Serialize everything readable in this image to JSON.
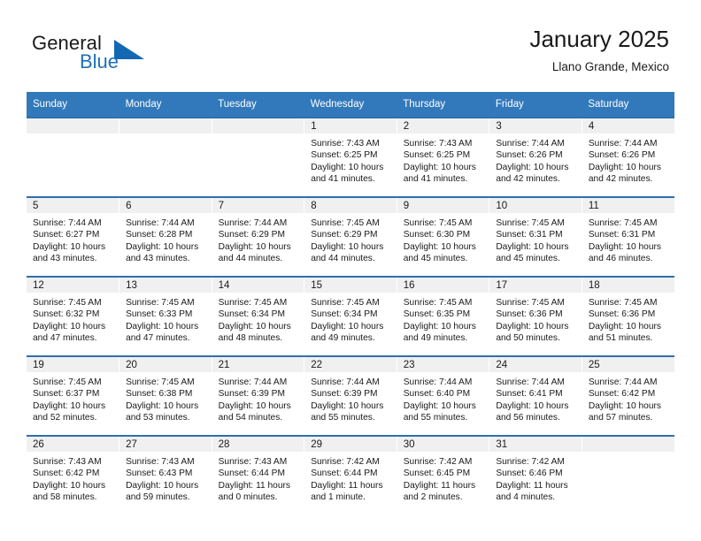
{
  "brand": {
    "name_part1": "General",
    "name_part2": "Blue",
    "logo_icon": "triangle-logo-icon",
    "accent_color": "#1368b3"
  },
  "header": {
    "title": "January 2025",
    "subtitle": "Llano Grande, Mexico"
  },
  "calendar": {
    "header_color": "#3279bb",
    "row_border_color": "#2f6fae",
    "daynum_band_color": "#f0f0f0",
    "weekday_headers": [
      "Sunday",
      "Monday",
      "Tuesday",
      "Wednesday",
      "Thursday",
      "Friday",
      "Saturday"
    ],
    "weeks": [
      [
        {
          "day": "",
          "empty": true,
          "sunrise": "",
          "sunset": "",
          "daylight_line1": "",
          "daylight_line2": ""
        },
        {
          "day": "",
          "empty": true,
          "sunrise": "",
          "sunset": "",
          "daylight_line1": "",
          "daylight_line2": ""
        },
        {
          "day": "",
          "empty": true,
          "sunrise": "",
          "sunset": "",
          "daylight_line1": "",
          "daylight_line2": ""
        },
        {
          "day": "1",
          "empty": false,
          "sunrise": "Sunrise: 7:43 AM",
          "sunset": "Sunset: 6:25 PM",
          "daylight_line1": "Daylight: 10 hours",
          "daylight_line2": "and 41 minutes."
        },
        {
          "day": "2",
          "empty": false,
          "sunrise": "Sunrise: 7:43 AM",
          "sunset": "Sunset: 6:25 PM",
          "daylight_line1": "Daylight: 10 hours",
          "daylight_line2": "and 41 minutes."
        },
        {
          "day": "3",
          "empty": false,
          "sunrise": "Sunrise: 7:44 AM",
          "sunset": "Sunset: 6:26 PM",
          "daylight_line1": "Daylight: 10 hours",
          "daylight_line2": "and 42 minutes."
        },
        {
          "day": "4",
          "empty": false,
          "sunrise": "Sunrise: 7:44 AM",
          "sunset": "Sunset: 6:26 PM",
          "daylight_line1": "Daylight: 10 hours",
          "daylight_line2": "and 42 minutes."
        }
      ],
      [
        {
          "day": "5",
          "empty": false,
          "sunrise": "Sunrise: 7:44 AM",
          "sunset": "Sunset: 6:27 PM",
          "daylight_line1": "Daylight: 10 hours",
          "daylight_line2": "and 43 minutes."
        },
        {
          "day": "6",
          "empty": false,
          "sunrise": "Sunrise: 7:44 AM",
          "sunset": "Sunset: 6:28 PM",
          "daylight_line1": "Daylight: 10 hours",
          "daylight_line2": "and 43 minutes."
        },
        {
          "day": "7",
          "empty": false,
          "sunrise": "Sunrise: 7:44 AM",
          "sunset": "Sunset: 6:29 PM",
          "daylight_line1": "Daylight: 10 hours",
          "daylight_line2": "and 44 minutes."
        },
        {
          "day": "8",
          "empty": false,
          "sunrise": "Sunrise: 7:45 AM",
          "sunset": "Sunset: 6:29 PM",
          "daylight_line1": "Daylight: 10 hours",
          "daylight_line2": "and 44 minutes."
        },
        {
          "day": "9",
          "empty": false,
          "sunrise": "Sunrise: 7:45 AM",
          "sunset": "Sunset: 6:30 PM",
          "daylight_line1": "Daylight: 10 hours",
          "daylight_line2": "and 45 minutes."
        },
        {
          "day": "10",
          "empty": false,
          "sunrise": "Sunrise: 7:45 AM",
          "sunset": "Sunset: 6:31 PM",
          "daylight_line1": "Daylight: 10 hours",
          "daylight_line2": "and 45 minutes."
        },
        {
          "day": "11",
          "empty": false,
          "sunrise": "Sunrise: 7:45 AM",
          "sunset": "Sunset: 6:31 PM",
          "daylight_line1": "Daylight: 10 hours",
          "daylight_line2": "and 46 minutes."
        }
      ],
      [
        {
          "day": "12",
          "empty": false,
          "sunrise": "Sunrise: 7:45 AM",
          "sunset": "Sunset: 6:32 PM",
          "daylight_line1": "Daylight: 10 hours",
          "daylight_line2": "and 47 minutes."
        },
        {
          "day": "13",
          "empty": false,
          "sunrise": "Sunrise: 7:45 AM",
          "sunset": "Sunset: 6:33 PM",
          "daylight_line1": "Daylight: 10 hours",
          "daylight_line2": "and 47 minutes."
        },
        {
          "day": "14",
          "empty": false,
          "sunrise": "Sunrise: 7:45 AM",
          "sunset": "Sunset: 6:34 PM",
          "daylight_line1": "Daylight: 10 hours",
          "daylight_line2": "and 48 minutes."
        },
        {
          "day": "15",
          "empty": false,
          "sunrise": "Sunrise: 7:45 AM",
          "sunset": "Sunset: 6:34 PM",
          "daylight_line1": "Daylight: 10 hours",
          "daylight_line2": "and 49 minutes."
        },
        {
          "day": "16",
          "empty": false,
          "sunrise": "Sunrise: 7:45 AM",
          "sunset": "Sunset: 6:35 PM",
          "daylight_line1": "Daylight: 10 hours",
          "daylight_line2": "and 49 minutes."
        },
        {
          "day": "17",
          "empty": false,
          "sunrise": "Sunrise: 7:45 AM",
          "sunset": "Sunset: 6:36 PM",
          "daylight_line1": "Daylight: 10 hours",
          "daylight_line2": "and 50 minutes."
        },
        {
          "day": "18",
          "empty": false,
          "sunrise": "Sunrise: 7:45 AM",
          "sunset": "Sunset: 6:36 PM",
          "daylight_line1": "Daylight: 10 hours",
          "daylight_line2": "and 51 minutes."
        }
      ],
      [
        {
          "day": "19",
          "empty": false,
          "sunrise": "Sunrise: 7:45 AM",
          "sunset": "Sunset: 6:37 PM",
          "daylight_line1": "Daylight: 10 hours",
          "daylight_line2": "and 52 minutes."
        },
        {
          "day": "20",
          "empty": false,
          "sunrise": "Sunrise: 7:45 AM",
          "sunset": "Sunset: 6:38 PM",
          "daylight_line1": "Daylight: 10 hours",
          "daylight_line2": "and 53 minutes."
        },
        {
          "day": "21",
          "empty": false,
          "sunrise": "Sunrise: 7:44 AM",
          "sunset": "Sunset: 6:39 PM",
          "daylight_line1": "Daylight: 10 hours",
          "daylight_line2": "and 54 minutes."
        },
        {
          "day": "22",
          "empty": false,
          "sunrise": "Sunrise: 7:44 AM",
          "sunset": "Sunset: 6:39 PM",
          "daylight_line1": "Daylight: 10 hours",
          "daylight_line2": "and 55 minutes."
        },
        {
          "day": "23",
          "empty": false,
          "sunrise": "Sunrise: 7:44 AM",
          "sunset": "Sunset: 6:40 PM",
          "daylight_line1": "Daylight: 10 hours",
          "daylight_line2": "and 55 minutes."
        },
        {
          "day": "24",
          "empty": false,
          "sunrise": "Sunrise: 7:44 AM",
          "sunset": "Sunset: 6:41 PM",
          "daylight_line1": "Daylight: 10 hours",
          "daylight_line2": "and 56 minutes."
        },
        {
          "day": "25",
          "empty": false,
          "sunrise": "Sunrise: 7:44 AM",
          "sunset": "Sunset: 6:42 PM",
          "daylight_line1": "Daylight: 10 hours",
          "daylight_line2": "and 57 minutes."
        }
      ],
      [
        {
          "day": "26",
          "empty": false,
          "sunrise": "Sunrise: 7:43 AM",
          "sunset": "Sunset: 6:42 PM",
          "daylight_line1": "Daylight: 10 hours",
          "daylight_line2": "and 58 minutes."
        },
        {
          "day": "27",
          "empty": false,
          "sunrise": "Sunrise: 7:43 AM",
          "sunset": "Sunset: 6:43 PM",
          "daylight_line1": "Daylight: 10 hours",
          "daylight_line2": "and 59 minutes."
        },
        {
          "day": "28",
          "empty": false,
          "sunrise": "Sunrise: 7:43 AM",
          "sunset": "Sunset: 6:44 PM",
          "daylight_line1": "Daylight: 11 hours",
          "daylight_line2": "and 0 minutes."
        },
        {
          "day": "29",
          "empty": false,
          "sunrise": "Sunrise: 7:42 AM",
          "sunset": "Sunset: 6:44 PM",
          "daylight_line1": "Daylight: 11 hours",
          "daylight_line2": "and 1 minute."
        },
        {
          "day": "30",
          "empty": false,
          "sunrise": "Sunrise: 7:42 AM",
          "sunset": "Sunset: 6:45 PM",
          "daylight_line1": "Daylight: 11 hours",
          "daylight_line2": "and 2 minutes."
        },
        {
          "day": "31",
          "empty": false,
          "sunrise": "Sunrise: 7:42 AM",
          "sunset": "Sunset: 6:46 PM",
          "daylight_line1": "Daylight: 11 hours",
          "daylight_line2": "and 4 minutes."
        },
        {
          "day": "",
          "empty": true,
          "sunrise": "",
          "sunset": "",
          "daylight_line1": "",
          "daylight_line2": ""
        }
      ]
    ]
  }
}
